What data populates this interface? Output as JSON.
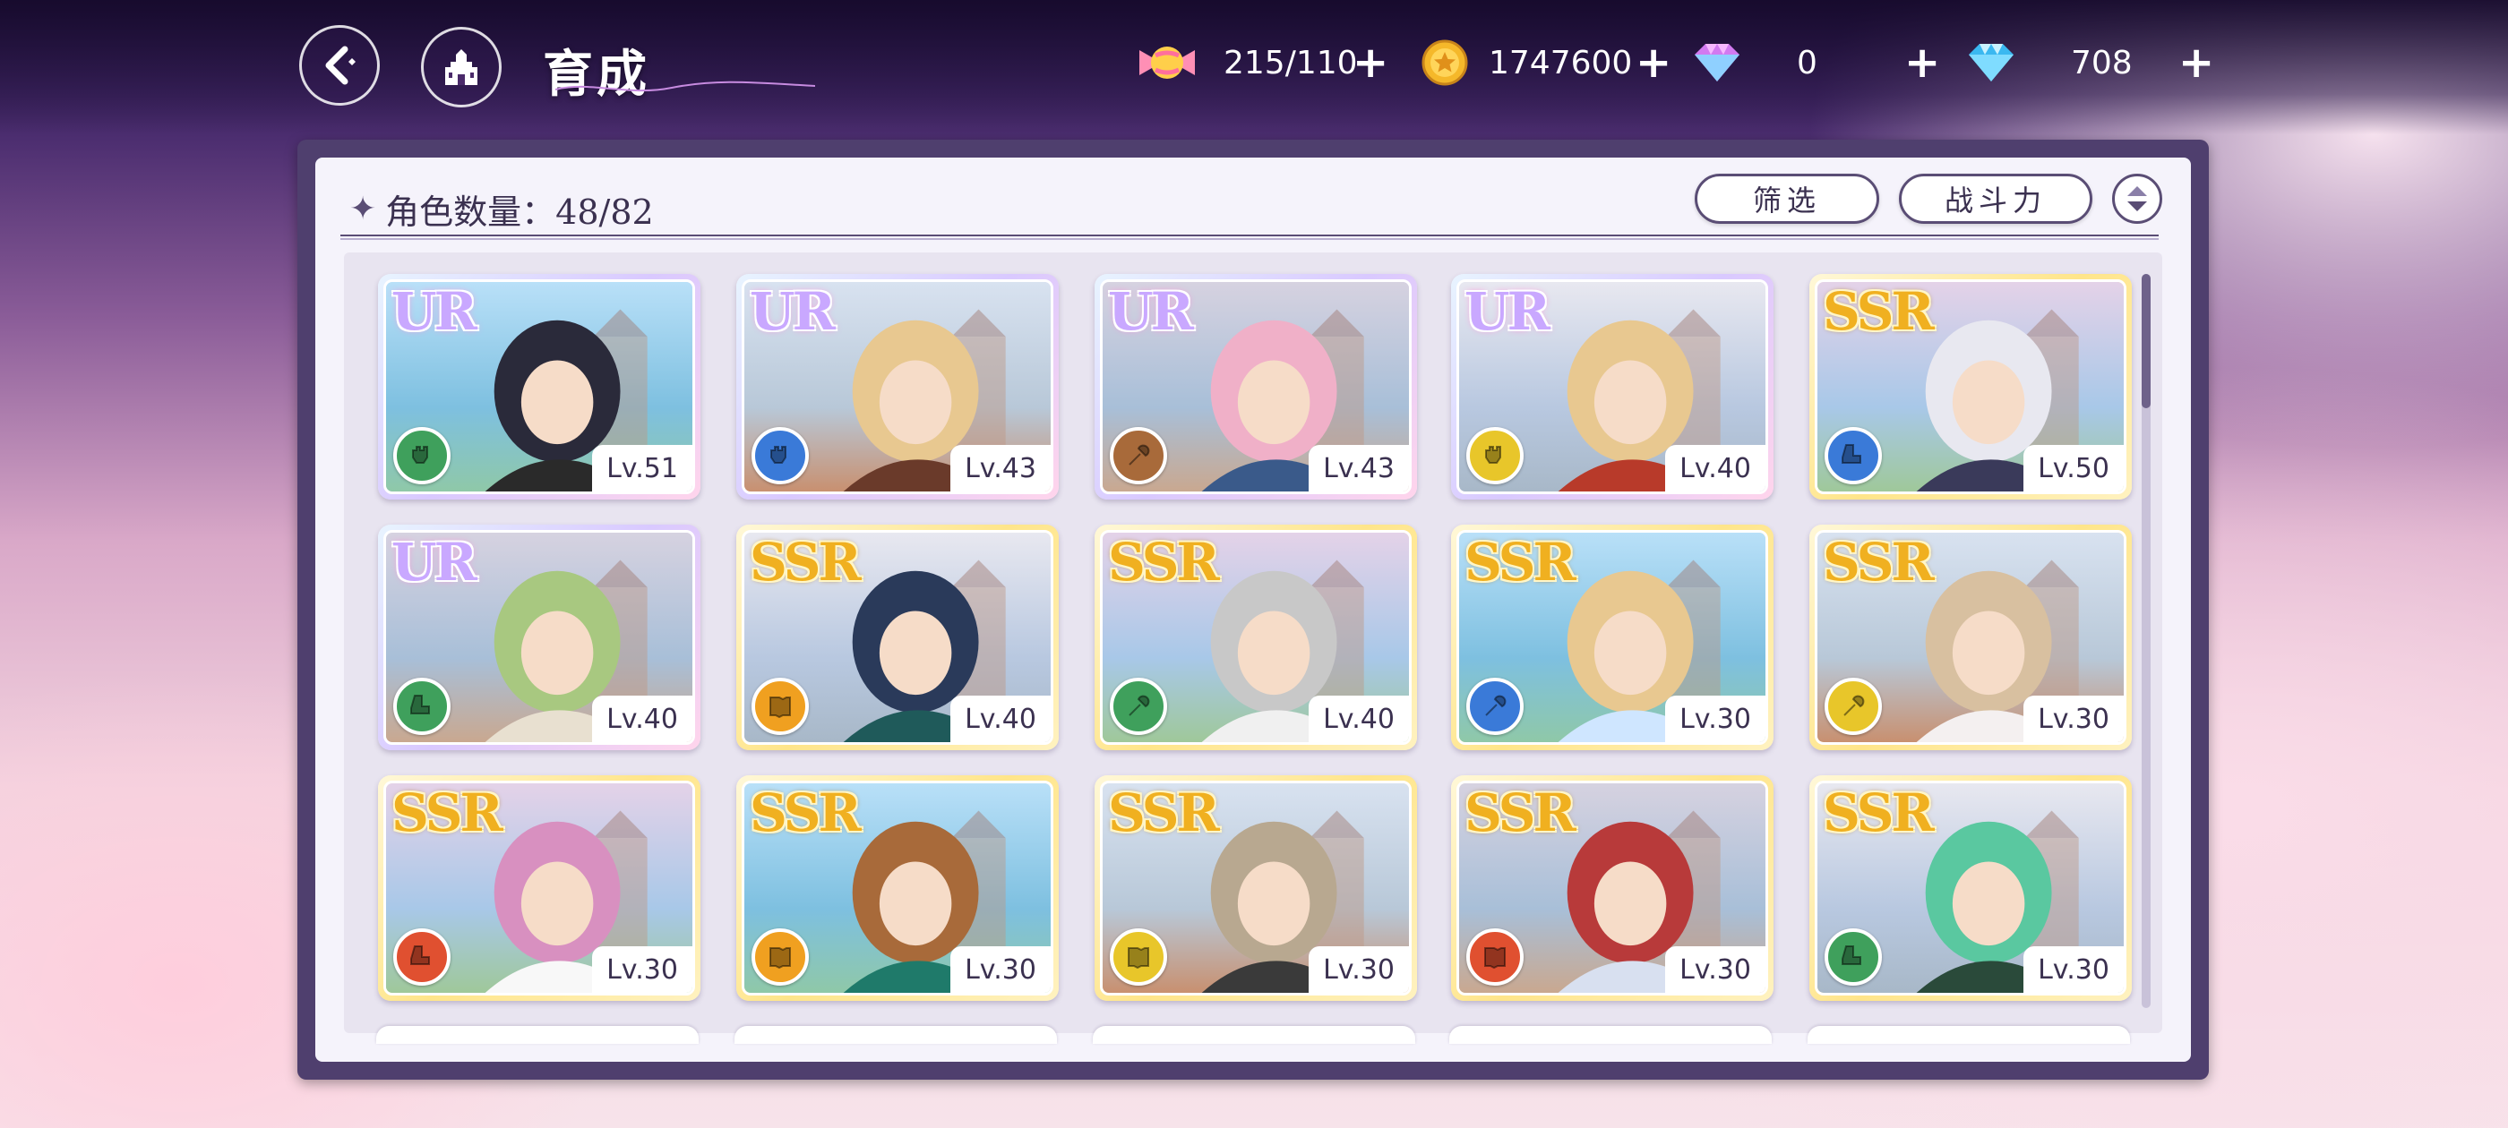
{
  "header": {
    "title": "育成",
    "stamina": "215/110",
    "gold": "1747600",
    "gems_pink": "0",
    "gems_blue": "708"
  },
  "panel": {
    "count_label": "角色数量：48/82",
    "filter_label": "筛选",
    "sort_label": "战斗力"
  },
  "colors": {
    "fist": "#3fa05c",
    "fist_blue": "#3a7ad8",
    "brown": "#a86a3a",
    "yellow": "#e8c62a",
    "orange": "#f0a020",
    "red": "#e05030",
    "green": "#3fa05c",
    "blue": "#3a7ad8"
  },
  "cards": [
    {
      "rarity": "UR",
      "level": "Lv.51",
      "attr_icon": "fist-icon",
      "attr_color": "#3fa05c"
    },
    {
      "rarity": "UR",
      "level": "Lv.43",
      "attr_icon": "fist-icon",
      "attr_color": "#3a7ad8"
    },
    {
      "rarity": "UR",
      "level": "Lv.43",
      "attr_icon": "wand-icon",
      "attr_color": "#a86a3a"
    },
    {
      "rarity": "UR",
      "level": "Lv.40",
      "attr_icon": "fist-icon",
      "attr_color": "#e8c62a"
    },
    {
      "rarity": "SSR",
      "level": "Lv.50",
      "attr_icon": "boot-icon",
      "attr_color": "#3a7ad8"
    },
    {
      "rarity": "UR",
      "level": "Lv.40",
      "attr_icon": "boot-icon",
      "attr_color": "#3fa05c"
    },
    {
      "rarity": "SSR",
      "level": "Lv.40",
      "attr_icon": "book-icon",
      "attr_color": "#f0a020"
    },
    {
      "rarity": "SSR",
      "level": "Lv.40",
      "attr_icon": "wand-icon",
      "attr_color": "#3fa05c"
    },
    {
      "rarity": "SSR",
      "level": "Lv.30",
      "attr_icon": "wand-icon",
      "attr_color": "#3a7ad8"
    },
    {
      "rarity": "SSR",
      "level": "Lv.30",
      "attr_icon": "wand-icon",
      "attr_color": "#e8c62a"
    },
    {
      "rarity": "SSR",
      "level": "Lv.30",
      "attr_icon": "boot-icon",
      "attr_color": "#e05030"
    },
    {
      "rarity": "SSR",
      "level": "Lv.30",
      "attr_icon": "book-icon",
      "attr_color": "#f0a020"
    },
    {
      "rarity": "SSR",
      "level": "Lv.30",
      "attr_icon": "book-icon",
      "attr_color": "#e8c62a"
    },
    {
      "rarity": "SSR",
      "level": "Lv.30",
      "attr_icon": "book-icon",
      "attr_color": "#e05030"
    },
    {
      "rarity": "SSR",
      "level": "Lv.30",
      "attr_icon": "boot-icon",
      "attr_color": "#3fa05c"
    }
  ]
}
